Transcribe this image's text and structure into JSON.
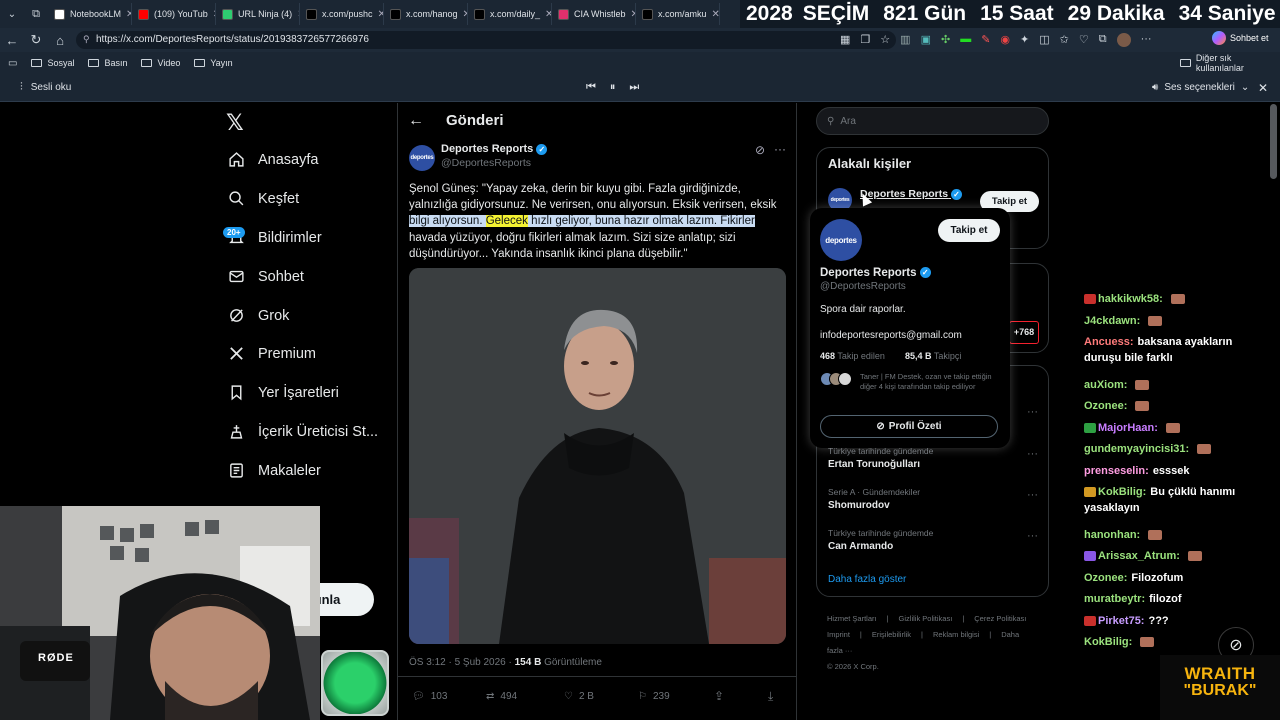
{
  "browser": {
    "tabs": [
      {
        "label": "NotebookLM",
        "color": "#ffffff"
      },
      {
        "label": "(109) YouTub",
        "color": "#ff0000"
      },
      {
        "label": "URL Ninja (4)",
        "color": "#2ecc71"
      },
      {
        "label": "x.com/pushc",
        "color": "#000000"
      },
      {
        "label": "x.com/hanog",
        "color": "#000000"
      },
      {
        "label": "x.com/daily_",
        "color": "#000000"
      },
      {
        "label": "CIA Whistleb",
        "color": "#e1306c"
      },
      {
        "label": "x.com/amku",
        "color": "#000000"
      }
    ],
    "url": "https://x.com/DeportesReports/status/2019383726577266976",
    "bookmarks": [
      "Sosyal",
      "Basın",
      "Video",
      "Yayın"
    ],
    "other_bookmarks": "Diğer sık kullanılanlar",
    "profile_label": "Sohbet et",
    "read_aloud": "Sesli oku",
    "voice_options": "Ses seçenekleri"
  },
  "countdown": {
    "year": "2028",
    "label": "SEÇİM",
    "days": "821 Gün",
    "hours": "15 Saat",
    "minutes": "29 Dakika",
    "seconds": "34 Saniye"
  },
  "nav": {
    "items": [
      {
        "label": "Anasayfa",
        "icon": "home-icon"
      },
      {
        "label": "Keşfet",
        "icon": "search-icon"
      },
      {
        "label": "Bildirimler",
        "icon": "bell-icon"
      },
      {
        "label": "Sohbet",
        "icon": "mail-icon"
      },
      {
        "label": "Grok",
        "icon": "grok-icon"
      },
      {
        "label": "Premium",
        "icon": "x-icon"
      },
      {
        "label": "Yer İşaretleri",
        "icon": "bookmark-icon"
      },
      {
        "label": "İçerik Üreticisi St...",
        "icon": "creator-icon"
      },
      {
        "label": "Makaleler",
        "icon": "article-icon"
      }
    ],
    "notif_badge": "20+",
    "post_button_fragment": "ınla"
  },
  "post": {
    "header": "Gönderi",
    "author_name": "Deportes Reports",
    "author_handle": "@DeportesReports",
    "avatar_text": "deportes",
    "text_a": "Şenol Güneş: \"Yapay zeka, derin bir kuyu gibi. Fazla girdiğinizde, yalnızlığa gidiyorsunuz. Ne verirsen, onu alıyorsun. Eksik verirsen, eksik ",
    "text_hl1": "bilgi alıyorsun. ",
    "text_hly": "Gelecek",
    "text_hl2": " hızlı geliyor, buna hazır olmak lazım. Fikirler",
    "text_b": " havada yüzüyor, doğru fikirleri almak lazım. Sizi size anlatıp; sizi düşündürüyor... Yakında insanlık ikinci plana düşebilir.\"",
    "time": "ÖS 3:12 · 5 Şub 2026 · ",
    "views_num": "154 B",
    "views_label": " Görüntüleme",
    "replies": "103",
    "reposts": "494",
    "likes": "2 B",
    "bookmarks": "239"
  },
  "right": {
    "search_placeholder": "Ara",
    "related_title": "Alakalı kişiler",
    "follow_label": "Takip et",
    "plus_count": "+768",
    "trends": [
      {
        "category": "Türkiye tarihinde gündemde",
        "name": "Ertan Torunoğulları"
      },
      {
        "category": "Serie A · Gündemdekiler",
        "name": "Shomurodov"
      },
      {
        "category": "Türkiye tarihinde gündemde",
        "name": "Can Armando"
      }
    ],
    "show_more": "Daha fazla göster",
    "footer_line1": [
      "Hizmet Şartları",
      "Gizlilik Politikası",
      "Çerez Politikası"
    ],
    "footer_line2": [
      "Imprint",
      "Erişilebilirlik",
      "Reklam bilgisi",
      "Daha fazla ···"
    ],
    "copyright": "© 2026 X Corp."
  },
  "popover": {
    "name": "Deportes Reports",
    "handle": "@DeportesReports",
    "bio": "Spora dair raporlar.",
    "email": "infodeportesreports@gmail.com",
    "following_num": "468",
    "following_label": " Takip edilen",
    "followers_num": "85,4 B",
    "followers_label": " Takipçi",
    "mutuals": "Taner | FM Destek, ozan ve takip ettiğin diğer 4 kişi tarafından takip ediliyor",
    "follow_label": "Takip et",
    "profile_summary": "Profil Özeti"
  },
  "chat": [
    {
      "user": "hakkikwk58:",
      "msg": "",
      "color": "#9be27e"
    },
    {
      "user": "J4ckdawn:",
      "msg": "",
      "color": "#9be27e"
    },
    {
      "user": "Ancuess:",
      "msg": "baksana ayakların",
      "color": "#ff7b7b"
    },
    {
      "user": "",
      "msg": "duruşu bile farklı",
      "color": "#ffffff"
    },
    {
      "user": "auXiom:",
      "msg": "",
      "color": "#9be27e"
    },
    {
      "user": "Ozonee:",
      "msg": "",
      "color": "#9be27e"
    },
    {
      "user": "MajorHaan:",
      "msg": "",
      "color": "#c87dff"
    },
    {
      "user": "gundemyayincisi31:",
      "msg": "",
      "color": "#9be27e"
    },
    {
      "user": "prenseselin:",
      "msg": "esssek",
      "color": "#ff9de2"
    },
    {
      "user": "KokBilig:",
      "msg": "Bu çüklü hanımı",
      "color": "#9be27e"
    },
    {
      "user": "",
      "msg": "yasaklayın",
      "color": "#ffffff"
    },
    {
      "user": "hanonhan:",
      "msg": "",
      "color": "#9be27e"
    },
    {
      "user": "Arissax_Atrum:",
      "msg": "",
      "color": "#9be27e"
    },
    {
      "user": "Ozonee:",
      "msg": "Filozofum",
      "color": "#9be27e"
    },
    {
      "user": "muratbeytr:",
      "msg": "filozof",
      "color": "#9be27e"
    },
    {
      "user": "Pirket75:",
      "msg": "???",
      "color": "#c89dff"
    },
    {
      "user": "KokBilig:",
      "msg": "",
      "color": "#9be27e"
    }
  ],
  "stream": {
    "logo_top": "WRAITH",
    "logo_bottom": "\"BURAK\"",
    "mic_label": "RØDE"
  }
}
